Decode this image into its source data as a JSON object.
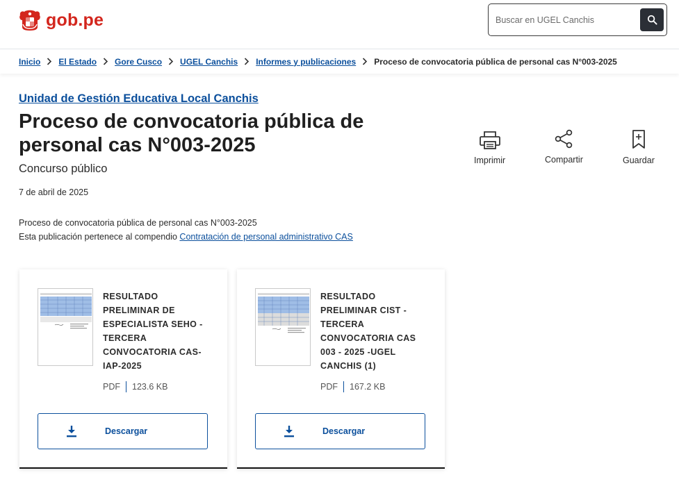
{
  "header": {
    "logo_text": "gob.pe",
    "search": {
      "placeholder": "Buscar en UGEL Canchis",
      "value": ""
    },
    "brand_color": "#d3261d"
  },
  "breadcrumb": {
    "links": [
      "Inicio",
      "El Estado",
      "Gore Cusco",
      "UGEL Canchis",
      "Informes y publicaciones"
    ],
    "current": "Proceso de convocatoria pública de personal cas N°003-2025"
  },
  "main": {
    "org": "Unidad de Gestión Educativa Local Canchis",
    "title": "Proceso de convocatoria pública de personal cas N°003-2025",
    "subtitle": "Concurso público",
    "date": "7 de abril de 2025",
    "description_line1": "Proceso de convocatoria pública de personal cas N°003-2025",
    "description_line2_prefix": "Esta publicación pertenece al compendio",
    "description_link": "Contratación de personal administrativo CAS"
  },
  "actions": {
    "print": "Imprimir",
    "share": "Compartir",
    "save": "Guardar"
  },
  "documents": [
    {
      "title": "RESULTADO PRELIMINAR DE ESPECIALISTA SEHO - TERCERA CONVOCATORIA CAS-IAP-2025",
      "format": "PDF",
      "size": "123.6 KB",
      "download_label": "Descargar"
    },
    {
      "title": "RESULTADO PRELIMINAR CIST - TERCERA CONVOCATORIA CAS 003 - 2025 -UGEL CANCHIS (1)",
      "format": "PDF",
      "size": "167.2 KB",
      "download_label": "Descargar"
    }
  ],
  "colors": {
    "link": "#0b4f9c",
    "text": "#1f1f1f",
    "search_button": "#2b2f36"
  },
  "icons": [
    "gob-pe-shield-icon",
    "search-icon",
    "chevron-right-icon",
    "printer-icon",
    "share-icon",
    "bookmark-icon",
    "download-icon",
    "pdf-thumbnail"
  ]
}
